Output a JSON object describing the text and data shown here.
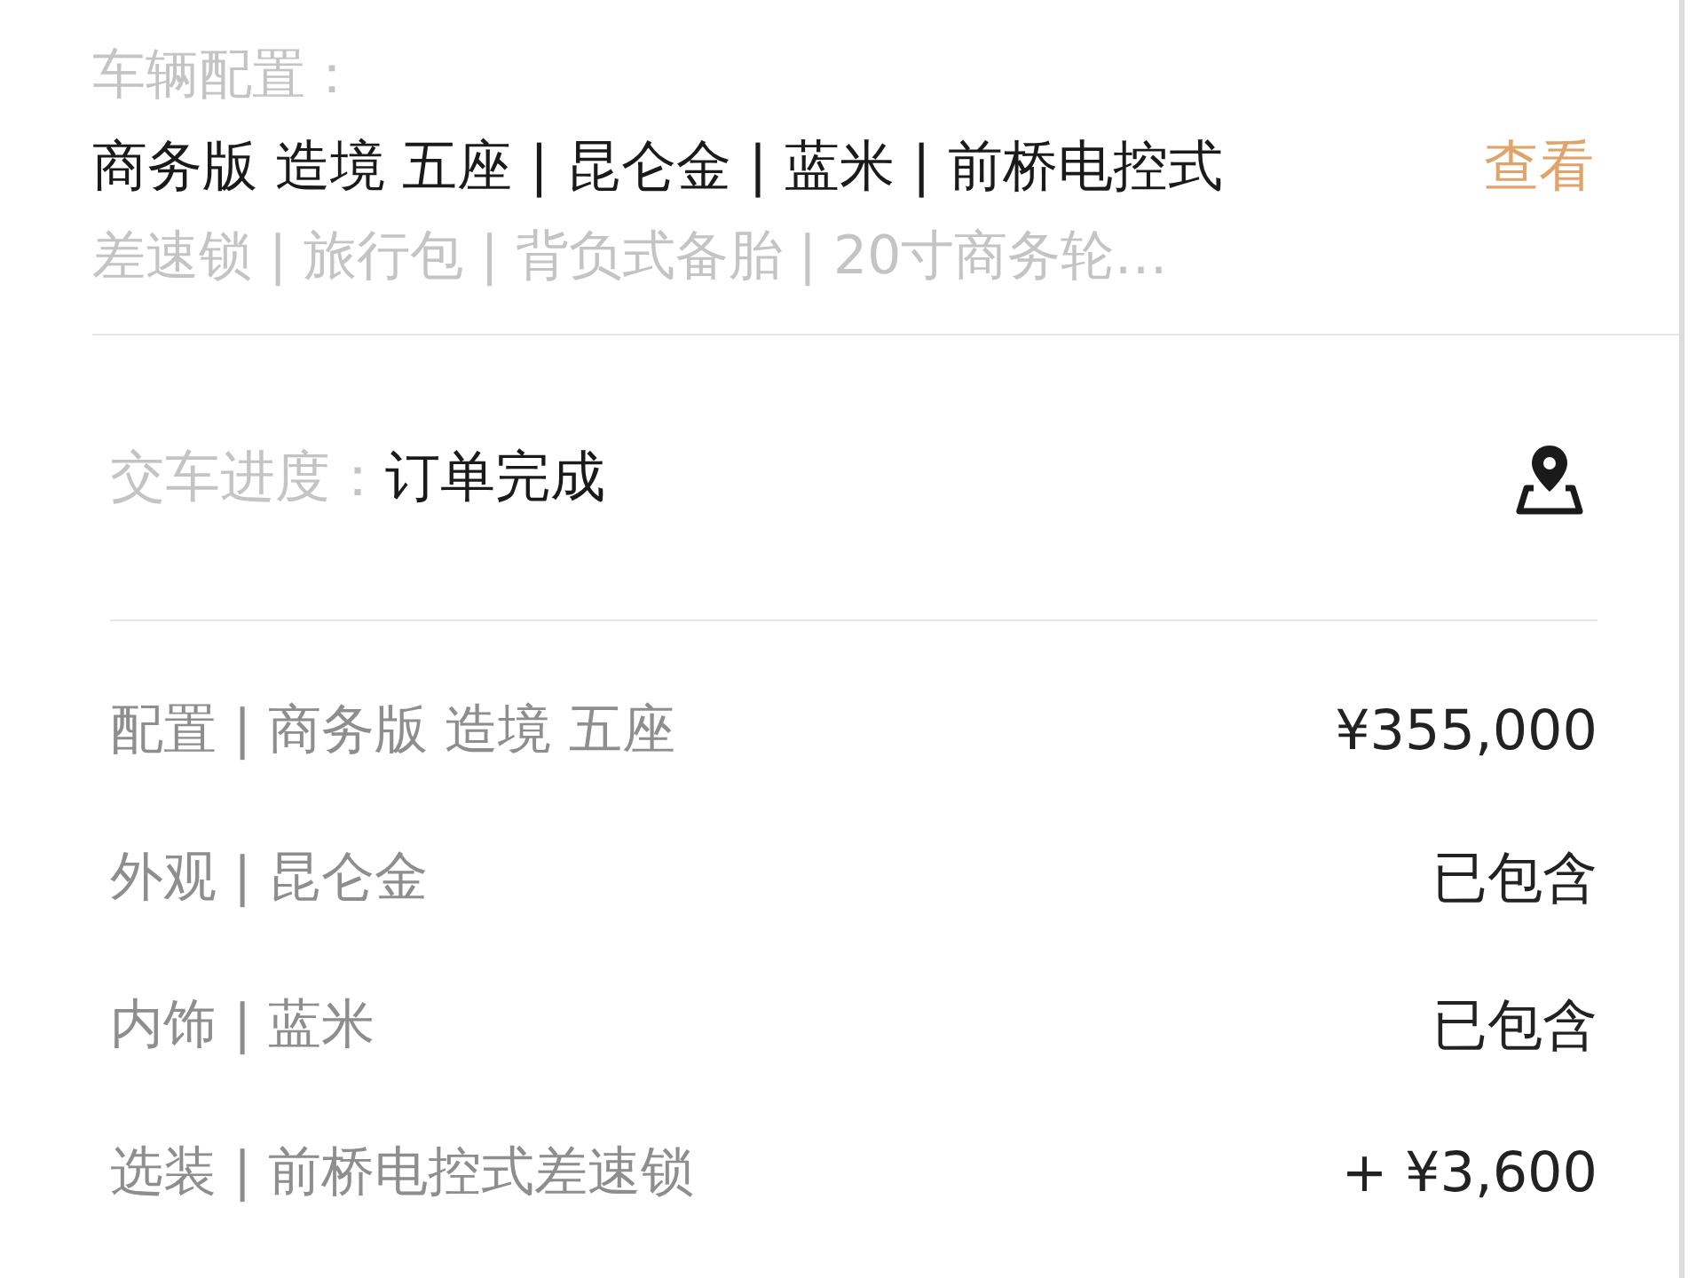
{
  "config": {
    "label": "车辆配置：",
    "summary": "商务版 造境 五座 | 昆仑金 | 蓝米 | 前桥电控式",
    "summary_more": "差速锁 | 旅行包 | 背负式备胎 | 20寸商务轮…",
    "link": "查看"
  },
  "progress": {
    "label": "交车进度：",
    "status": "订单完成"
  },
  "items": [
    {
      "name": "配置 | 商务版 造境 五座",
      "price": "¥355,000"
    },
    {
      "name": "外观 | 昆仑金",
      "price": "已包含"
    },
    {
      "name": "内饰 | 蓝米",
      "price": "已包含"
    },
    {
      "name": "选装 | 前桥电控式差速锁",
      "price": "+ ¥3,600"
    }
  ]
}
